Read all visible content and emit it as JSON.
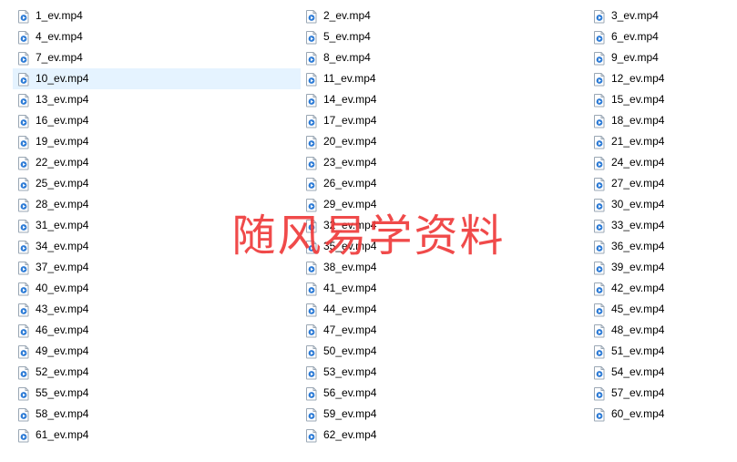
{
  "watermark": "随风易学资料",
  "selected_index": 9,
  "files": [
    {
      "name": "1_ev.mp4"
    },
    {
      "name": "2_ev.mp4"
    },
    {
      "name": "3_ev.mp4"
    },
    {
      "name": "4_ev.mp4"
    },
    {
      "name": "5_ev.mp4"
    },
    {
      "name": "6_ev.mp4"
    },
    {
      "name": "7_ev.mp4"
    },
    {
      "name": "8_ev.mp4"
    },
    {
      "name": "9_ev.mp4"
    },
    {
      "name": "10_ev.mp4"
    },
    {
      "name": "11_ev.mp4"
    },
    {
      "name": "12_ev.mp4"
    },
    {
      "name": "13_ev.mp4"
    },
    {
      "name": "14_ev.mp4"
    },
    {
      "name": "15_ev.mp4"
    },
    {
      "name": "16_ev.mp4"
    },
    {
      "name": "17_ev.mp4"
    },
    {
      "name": "18_ev.mp4"
    },
    {
      "name": "19_ev.mp4"
    },
    {
      "name": "20_ev.mp4"
    },
    {
      "name": "21_ev.mp4"
    },
    {
      "name": "22_ev.mp4"
    },
    {
      "name": "23_ev.mp4"
    },
    {
      "name": "24_ev.mp4"
    },
    {
      "name": "25_ev.mp4"
    },
    {
      "name": "26_ev.mp4"
    },
    {
      "name": "27_ev.mp4"
    },
    {
      "name": "28_ev.mp4"
    },
    {
      "name": "29_ev.mp4"
    },
    {
      "name": "30_ev.mp4"
    },
    {
      "name": "31_ev.mp4"
    },
    {
      "name": "32_ev.mp4"
    },
    {
      "name": "33_ev.mp4"
    },
    {
      "name": "34_ev.mp4"
    },
    {
      "name": "35_ev.mp4"
    },
    {
      "name": "36_ev.mp4"
    },
    {
      "name": "37_ev.mp4"
    },
    {
      "name": "38_ev.mp4"
    },
    {
      "name": "39_ev.mp4"
    },
    {
      "name": "40_ev.mp4"
    },
    {
      "name": "41_ev.mp4"
    },
    {
      "name": "42_ev.mp4"
    },
    {
      "name": "43_ev.mp4"
    },
    {
      "name": "44_ev.mp4"
    },
    {
      "name": "45_ev.mp4"
    },
    {
      "name": "46_ev.mp4"
    },
    {
      "name": "47_ev.mp4"
    },
    {
      "name": "48_ev.mp4"
    },
    {
      "name": "49_ev.mp4"
    },
    {
      "name": "50_ev.mp4"
    },
    {
      "name": "51_ev.mp4"
    },
    {
      "name": "52_ev.mp4"
    },
    {
      "name": "53_ev.mp4"
    },
    {
      "name": "54_ev.mp4"
    },
    {
      "name": "55_ev.mp4"
    },
    {
      "name": "56_ev.mp4"
    },
    {
      "name": "57_ev.mp4"
    },
    {
      "name": "58_ev.mp4"
    },
    {
      "name": "59_ev.mp4"
    },
    {
      "name": "60_ev.mp4"
    },
    {
      "name": "61_ev.mp4"
    },
    {
      "name": "62_ev.mp4"
    }
  ]
}
